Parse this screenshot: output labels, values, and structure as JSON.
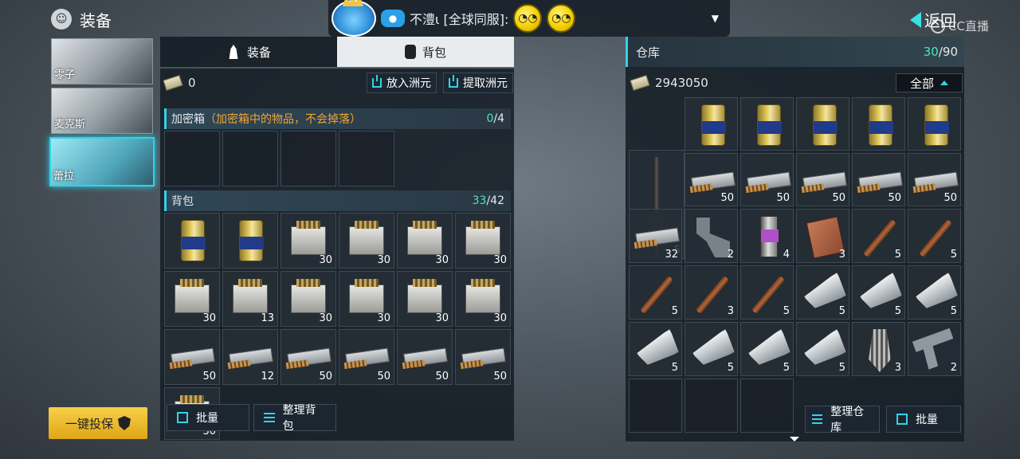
{
  "header": {
    "title": "装备",
    "back_label": "返回",
    "watermark": "CC直播"
  },
  "chat": {
    "text": "不澧ι [全球同服]:",
    "emoji_count": 2
  },
  "characters": [
    {
      "name": "零子",
      "selected": false
    },
    {
      "name": "麦克斯",
      "selected": false
    },
    {
      "name": "蕾拉",
      "selected": true
    }
  ],
  "insure_button": "一键投保",
  "left_tabs": [
    {
      "label": "装备",
      "active": false
    },
    {
      "label": "背包",
      "active": true
    }
  ],
  "money": {
    "amount": "0",
    "deposit": "放入洲元",
    "withdraw": "提取洲元"
  },
  "secure_box": {
    "title": "加密箱",
    "note": "（加密箱中的物品，不会掉落）",
    "count": "0",
    "capacity": "/4"
  },
  "backpack": {
    "title": "背包",
    "count": "33",
    "capacity": "/42",
    "items": [
      {
        "type": "can",
        "qty": ""
      },
      {
        "type": "can",
        "qty": ""
      },
      {
        "type": "box",
        "qty": "30"
      },
      {
        "type": "box",
        "qty": "30"
      },
      {
        "type": "box",
        "qty": "30"
      },
      {
        "type": "box",
        "qty": "30"
      },
      {
        "type": "box",
        "qty": "30"
      },
      {
        "type": "box",
        "qty": "13"
      },
      {
        "type": "box",
        "qty": "30"
      },
      {
        "type": "box",
        "qty": "30"
      },
      {
        "type": "box",
        "qty": "30"
      },
      {
        "type": "box",
        "qty": "30"
      },
      {
        "type": "ammo",
        "qty": "50"
      },
      {
        "type": "ammo",
        "qty": "12"
      },
      {
        "type": "ammo",
        "qty": "50"
      },
      {
        "type": "ammo",
        "qty": "50"
      },
      {
        "type": "ammo",
        "qty": "50"
      },
      {
        "type": "ammo",
        "qty": "50"
      }
    ],
    "batch_label": "批量",
    "sort_label": "整理背包"
  },
  "warehouse": {
    "title": "仓库",
    "count": "30",
    "capacity": "/90",
    "money": "2943050",
    "filter": "全部",
    "sort_label": "整理仓库",
    "batch_label": "批量",
    "rifle_qty": "5",
    "row1": [
      {
        "type": "can",
        "qty": ""
      },
      {
        "type": "can",
        "qty": ""
      },
      {
        "type": "can",
        "qty": ""
      },
      {
        "type": "can",
        "qty": ""
      },
      {
        "type": "can",
        "qty": ""
      }
    ],
    "row2": [
      {
        "type": "ammo",
        "qty": "50"
      },
      {
        "type": "ammo",
        "qty": "50"
      },
      {
        "type": "ammo",
        "qty": "50"
      },
      {
        "type": "ammo",
        "qty": "50"
      },
      {
        "type": "ammo",
        "qty": "50"
      }
    ],
    "row3": [
      {
        "type": "ammo",
        "qty": "32"
      },
      {
        "type": "part",
        "qty": "2"
      },
      {
        "type": "canister",
        "qty": "4"
      },
      {
        "type": "plate",
        "qty": "3"
      },
      {
        "type": "bat",
        "qty": "5"
      },
      {
        "type": "bat",
        "qty": "5"
      }
    ],
    "row4": [
      {
        "type": "bat",
        "qty": "5"
      },
      {
        "type": "bat",
        "qty": "3"
      },
      {
        "type": "bat",
        "qty": "5"
      },
      {
        "type": "mag",
        "qty": "5"
      },
      {
        "type": "mag",
        "qty": "5"
      },
      {
        "type": "mag",
        "qty": "5"
      }
    ],
    "row5": [
      {
        "type": "mag",
        "qty": "5"
      },
      {
        "type": "mag",
        "qty": "5"
      },
      {
        "type": "mag",
        "qty": "5"
      },
      {
        "type": "mag",
        "qty": "5"
      },
      {
        "type": "drill",
        "qty": "3"
      },
      {
        "type": "pistol",
        "qty": "2"
      }
    ]
  }
}
